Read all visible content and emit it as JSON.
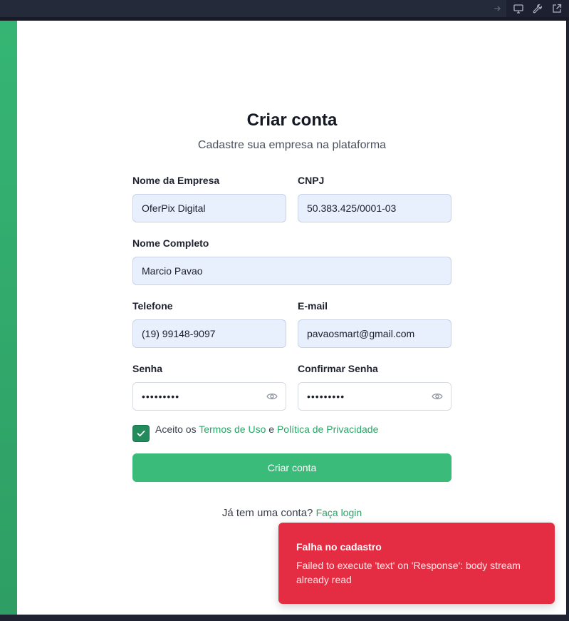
{
  "topbar": {
    "icons": [
      "arrow-right-icon",
      "monitor-icon",
      "wrench-icon",
      "external-link-icon"
    ]
  },
  "form": {
    "title": "Criar conta",
    "subtitle": "Cadastre sua empresa na plataforma",
    "company": {
      "label": "Nome da Empresa",
      "value": "OferPix Digital"
    },
    "cnpj": {
      "label": "CNPJ",
      "value": "50.383.425/0001-03"
    },
    "fullname": {
      "label": "Nome Completo",
      "value": "Marcio Pavao"
    },
    "phone": {
      "label": "Telefone",
      "value": "(19) 99148-9097"
    },
    "email": {
      "label": "E-mail",
      "value": "pavaosmart@gmail.com"
    },
    "password": {
      "label": "Senha",
      "value": "•••••••••"
    },
    "confirm_password": {
      "label": "Confirmar Senha",
      "value": "•••••••••"
    },
    "terms": {
      "checked": true,
      "prefix": "Aceito os ",
      "terms_link": "Termos de Uso",
      "middle": " e ",
      "privacy_link": "Política de Privacidade"
    },
    "submit_label": "Criar conta",
    "login_prompt": "Já tem uma conta? ",
    "login_link": "Faça login"
  },
  "toast": {
    "title": "Falha no cadastro",
    "message": "Failed to execute 'text' on 'Response': body stream already read"
  },
  "colors": {
    "accent": "#3abb79",
    "link": "#2aa567",
    "error": "#e42d42"
  }
}
